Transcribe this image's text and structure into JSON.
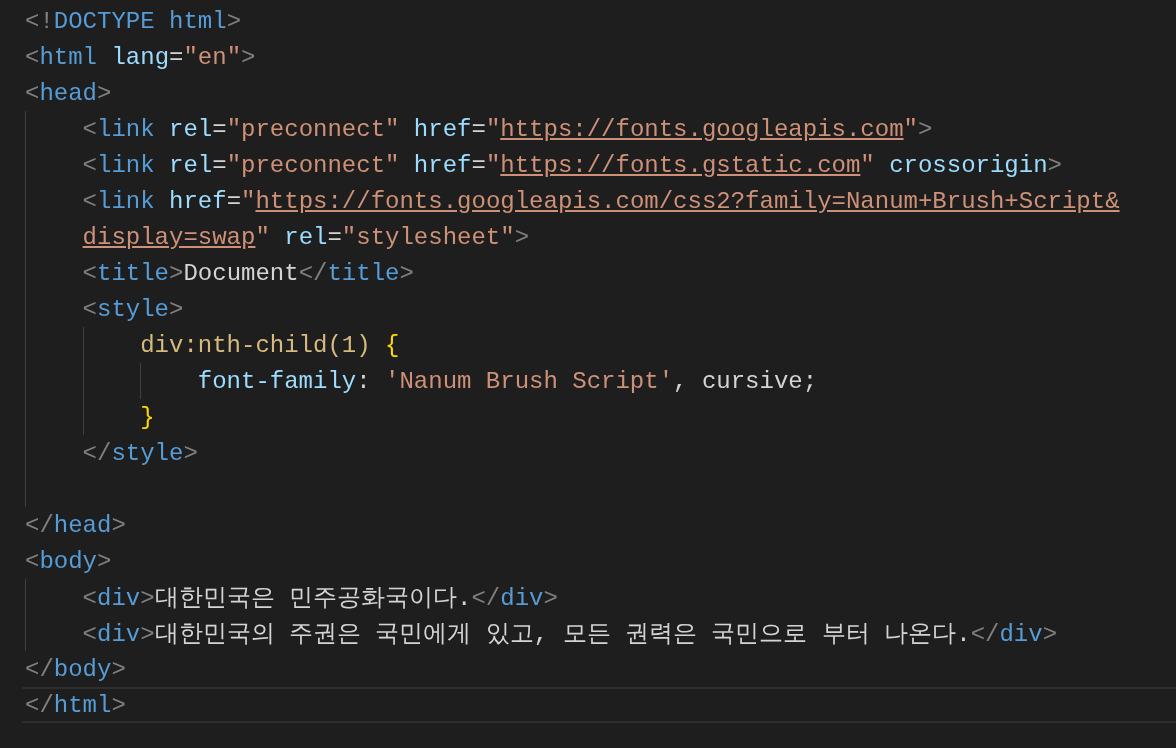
{
  "lines": [
    {
      "kind": "code",
      "active": false,
      "tokens": [
        {
          "kind": "punct",
          "text": "<!"
        },
        {
          "kind": "tag",
          "text": "DOCTYPE html"
        },
        {
          "kind": "punct",
          "text": ">"
        }
      ]
    },
    {
      "kind": "code",
      "active": false,
      "tokens": [
        {
          "kind": "punct",
          "text": "<"
        },
        {
          "kind": "tag",
          "text": "html"
        },
        {
          "kind": "attr",
          "text": " lang"
        },
        {
          "kind": "text",
          "text": "="
        },
        {
          "kind": "string",
          "text": "\"en\""
        },
        {
          "kind": "punct",
          "text": ">"
        }
      ]
    },
    {
      "kind": "code",
      "active": false,
      "tokens": [
        {
          "kind": "punct",
          "text": "<"
        },
        {
          "kind": "tag",
          "text": "head"
        },
        {
          "kind": "punct",
          "text": ">"
        }
      ],
      "children": [
        {
          "kind": "code",
          "active": false,
          "tokens": [
            {
              "kind": "punct",
              "text": "<"
            },
            {
              "kind": "tag",
              "text": "link"
            },
            {
              "kind": "attr",
              "text": " rel"
            },
            {
              "kind": "text",
              "text": "="
            },
            {
              "kind": "string",
              "text": "\"preconnect\""
            },
            {
              "kind": "attr",
              "text": " href"
            },
            {
              "kind": "text",
              "text": "="
            },
            {
              "kind": "string",
              "text": "\""
            },
            {
              "kind": "link",
              "text": "https://fonts.googleapis.com"
            },
            {
              "kind": "string",
              "text": "\""
            },
            {
              "kind": "punct",
              "text": ">"
            }
          ]
        },
        {
          "kind": "code",
          "active": false,
          "tokens": [
            {
              "kind": "punct",
              "text": "<"
            },
            {
              "kind": "tag",
              "text": "link"
            },
            {
              "kind": "attr",
              "text": " rel"
            },
            {
              "kind": "text",
              "text": "="
            },
            {
              "kind": "string",
              "text": "\"preconnect\""
            },
            {
              "kind": "attr",
              "text": " href"
            },
            {
              "kind": "text",
              "text": "="
            },
            {
              "kind": "string",
              "text": "\""
            },
            {
              "kind": "link",
              "text": "https://fonts.gstatic.com"
            },
            {
              "kind": "string",
              "text": "\""
            },
            {
              "kind": "attr",
              "text": " crossorigin"
            },
            {
              "kind": "punct",
              "text": ">"
            }
          ]
        },
        {
          "kind": "code",
          "active": false,
          "tokens": [
            {
              "kind": "punct",
              "text": "<"
            },
            {
              "kind": "tag",
              "text": "link"
            },
            {
              "kind": "attr",
              "text": " href"
            },
            {
              "kind": "text",
              "text": "="
            },
            {
              "kind": "string",
              "text": "\""
            },
            {
              "kind": "link",
              "text": "https://fonts.googleapis.com/css2?family=Nanum+Brush+Script&"
            }
          ]
        },
        {
          "kind": "code",
          "active": false,
          "tokens": [
            {
              "kind": "link",
              "text": "display=swap"
            },
            {
              "kind": "string",
              "text": "\""
            },
            {
              "kind": "attr",
              "text": " rel"
            },
            {
              "kind": "text",
              "text": "="
            },
            {
              "kind": "string",
              "text": "\"stylesheet\""
            },
            {
              "kind": "punct",
              "text": ">"
            }
          ]
        },
        {
          "kind": "code",
          "active": false,
          "tokens": [
            {
              "kind": "punct",
              "text": "<"
            },
            {
              "kind": "tag",
              "text": "title"
            },
            {
              "kind": "punct",
              "text": ">"
            },
            {
              "kind": "text",
              "text": "Document"
            },
            {
              "kind": "punct",
              "text": "</"
            },
            {
              "kind": "tag",
              "text": "title"
            },
            {
              "kind": "punct",
              "text": ">"
            }
          ]
        },
        {
          "kind": "code",
          "active": false,
          "tokens": [
            {
              "kind": "punct",
              "text": "<"
            },
            {
              "kind": "tag",
              "text": "style"
            },
            {
              "kind": "punct",
              "text": ">"
            }
          ],
          "children": [
            {
              "kind": "code",
              "active": false,
              "tokens": [
                {
                  "kind": "selector",
                  "text": "div:nth-child(1)"
                },
                {
                  "kind": "brace",
                  "text": " {"
                }
              ],
              "children": [
                {
                  "kind": "code",
                  "active": false,
                  "tokens": [
                    {
                      "kind": "attr",
                      "text": "font-family"
                    },
                    {
                      "kind": "text",
                      "text": ":"
                    },
                    {
                      "kind": "string",
                      "text": " 'Nanum Brush Script'"
                    },
                    {
                      "kind": "text",
                      "text": ", cursive;"
                    }
                  ]
                }
              ]
            },
            {
              "kind": "code",
              "active": false,
              "tokens": [
                {
                  "kind": "brace",
                  "text": "}"
                }
              ]
            }
          ]
        },
        {
          "kind": "code",
          "active": false,
          "tokens": [
            {
              "kind": "punct",
              "text": "</"
            },
            {
              "kind": "tag",
              "text": "style"
            },
            {
              "kind": "punct",
              "text": ">"
            }
          ]
        },
        {
          "kind": "blank"
        }
      ]
    },
    {
      "kind": "code",
      "active": false,
      "tokens": [
        {
          "kind": "punct",
          "text": "</"
        },
        {
          "kind": "tag",
          "text": "head"
        },
        {
          "kind": "punct",
          "text": ">"
        }
      ]
    },
    {
      "kind": "code",
      "active": false,
      "tokens": [
        {
          "kind": "punct",
          "text": "<"
        },
        {
          "kind": "tag",
          "text": "body"
        },
        {
          "kind": "punct",
          "text": ">"
        }
      ],
      "children": [
        {
          "kind": "code",
          "active": false,
          "tokens": [
            {
              "kind": "punct",
              "text": "<"
            },
            {
              "kind": "tag",
              "text": "div"
            },
            {
              "kind": "punct",
              "text": ">"
            },
            {
              "kind": "text",
              "text": "대한민국은 민주공화국이다."
            },
            {
              "kind": "punct",
              "text": "</"
            },
            {
              "kind": "tag",
              "text": "div"
            },
            {
              "kind": "punct",
              "text": ">"
            }
          ]
        },
        {
          "kind": "code",
          "active": false,
          "tokens": [
            {
              "kind": "punct",
              "text": "<"
            },
            {
              "kind": "tag",
              "text": "div"
            },
            {
              "kind": "punct",
              "text": ">"
            },
            {
              "kind": "text",
              "text": "대한민국의 주권은 국민에게 있고, 모든 권력은 국민으로 부터 나온다."
            },
            {
              "kind": "punct",
              "text": "</"
            },
            {
              "kind": "tag",
              "text": "div"
            },
            {
              "kind": "punct",
              "text": ">"
            }
          ]
        }
      ]
    },
    {
      "kind": "code",
      "active": false,
      "tokens": [
        {
          "kind": "punct",
          "text": "</"
        },
        {
          "kind": "tag",
          "text": "body"
        },
        {
          "kind": "punct",
          "text": ">"
        }
      ]
    },
    {
      "kind": "code",
      "active": true,
      "tokens": [
        {
          "kind": "punct",
          "text": "</"
        },
        {
          "kind": "tag",
          "text": "html"
        },
        {
          "kind": "punct",
          "text": ">"
        }
      ]
    }
  ]
}
